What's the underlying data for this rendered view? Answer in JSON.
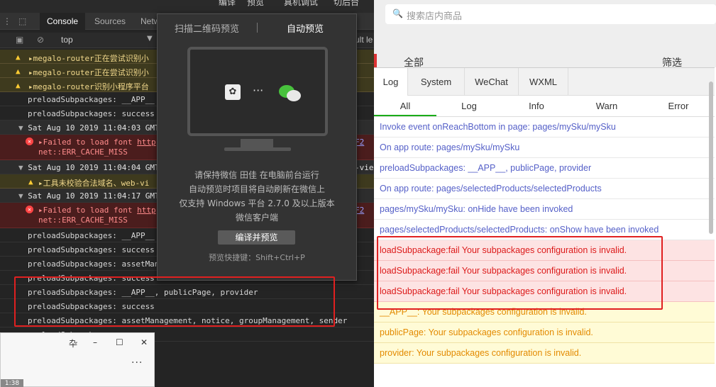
{
  "devtools": {
    "tabs": {
      "console": "Console",
      "sources": "Sources",
      "network": "Netw"
    },
    "context": "top",
    "levels": "ult le",
    "logs": [
      {
        "type": "warn",
        "text": "megalo-router正在尝试识别小"
      },
      {
        "type": "warn",
        "text": "megalo-router正在尝试识别小"
      },
      {
        "type": "warn",
        "text": "megalo-router识别小程序平台"
      },
      {
        "type": "info",
        "text": "preloadSubpackages: __APP__"
      },
      {
        "type": "info",
        "text": "preloadSubpackages: success"
      },
      {
        "type": "group",
        "text": "Sat Aug 10 2019 11:04:03 GMT"
      },
      {
        "type": "err",
        "text": "Failed to load font http",
        "text2": "net::ERR_CACHE_MISS",
        "suffix": "F2"
      },
      {
        "type": "group",
        "text": "Sat Aug 10 2019 11:04:04 GMT",
        "suffix": "-vie"
      },
      {
        "type": "warn2",
        "text": "工具未校验合法域名、web-vi"
      },
      {
        "type": "group",
        "text": "Sat Aug 10 2019 11:04:17 GMT"
      },
      {
        "type": "err",
        "text": "Failed to load font http",
        "text2": "net::ERR_CACHE_MISS",
        "suffix": "F2"
      },
      {
        "type": "info",
        "text": "preloadSubpackages: __APP__"
      },
      {
        "type": "info",
        "text": "preloadSubpackages: success"
      },
      {
        "type": "info",
        "text": "preloadSubpackages: assetMan"
      },
      {
        "type": "info",
        "text": "preloadSubpackages: success"
      },
      {
        "type": "info",
        "text": "preloadSubpackages: __APP__, publicPage, provider"
      },
      {
        "type": "info",
        "text": "preloadSubpackages: success"
      },
      {
        "type": "info",
        "text": "preloadSubpackages: assetManagement, notice, groupManagement, sender"
      },
      {
        "type": "info",
        "text": "preloadSubpackages: success"
      }
    ]
  },
  "menubar": {
    "compile": "编译",
    "preview": "预览",
    "remote": "真机调试",
    "cut": "切后台"
  },
  "popup": {
    "tab_scan": "扫描二维码预览",
    "tab_auto": "自动预览",
    "dots": "···",
    "app_icon": "app-icon",
    "wechat_icon": "wechat-icon",
    "msg1": "请保持微信 田佳 在电脑前台运行",
    "msg2": "自动预览时项目将自动刷新在微信上",
    "msg3": "仅支持 Windows 平台 2.7.0 及以上版本",
    "msg4": "微信客户端",
    "button": "编译并预览",
    "hint": "预览快捷键：Shift+Ctrl+P"
  },
  "smallwin": {
    "pin": "卆",
    "min": "–",
    "max": "☐",
    "close": "✕",
    "more": "···",
    "time": "1:38"
  },
  "sim": {
    "search_placeholder": "搜索店内商品",
    "all": "全部",
    "filter": "筛选",
    "tabs": [
      "Log",
      "System",
      "WeChat",
      "WXML"
    ],
    "subtabs": [
      "All",
      "Log",
      "Info",
      "Warn",
      "Error"
    ],
    "rows": [
      {
        "type": "log",
        "text": "Invoke event onReachBottom in page: pages/mySku/mySku"
      },
      {
        "type": "log",
        "text": "On app route: pages/mySku/mySku"
      },
      {
        "type": "log",
        "text": "preloadSubpackages: __APP__, publicPage, provider"
      },
      {
        "type": "log",
        "text": "On app route: pages/selectedProducts/selectedProducts"
      },
      {
        "type": "log",
        "text": "pages/mySku/mySku: onHide have been invoked"
      },
      {
        "type": "log",
        "text": "pages/selectedProducts/selectedProducts: onShow have been invoked"
      },
      {
        "type": "err",
        "text": "loadSubpackage:fail Your subpackages configuration is invalid."
      },
      {
        "type": "err",
        "text": "loadSubpackage:fail Your subpackages configuration is invalid."
      },
      {
        "type": "err",
        "text": "loadSubpackage:fail Your subpackages configuration is invalid."
      },
      {
        "type": "warn",
        "text": "__APP__: Your subpackages configuration is invalid."
      },
      {
        "type": "warn",
        "text": "publicPage: Your subpackages configuration is invalid."
      },
      {
        "type": "warn",
        "text": "provider: Your subpackages configuration is invalid."
      }
    ]
  }
}
